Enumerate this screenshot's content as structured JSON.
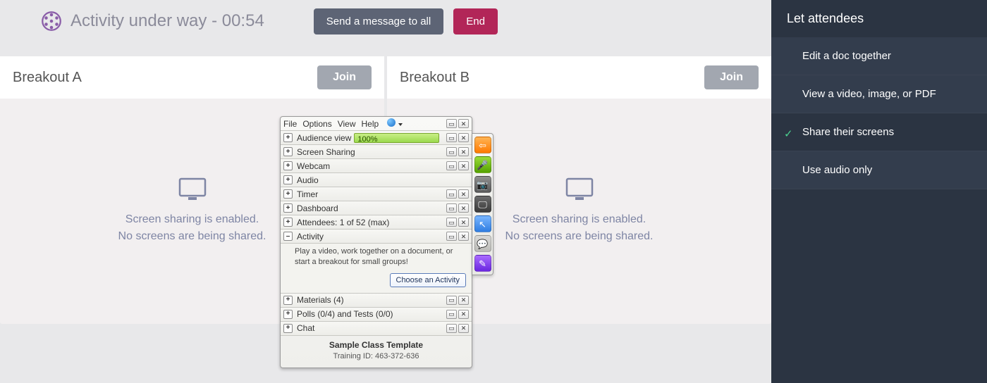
{
  "header": {
    "title": "Activity under way - 00:54",
    "send_all_label": "Send a message to all",
    "end_label": "End"
  },
  "breakouts": [
    {
      "name": "Breakout A",
      "join_label": "Join",
      "msg1": "Screen sharing is enabled.",
      "msg2": "No screens are being shared."
    },
    {
      "name": "Breakout B",
      "join_label": "Join",
      "msg1": "Screen sharing is enabled.",
      "msg2": "No screens are being shared."
    }
  ],
  "rightbar": {
    "title": "Let attendees",
    "items": [
      {
        "label": "Edit a doc together",
        "selected": false
      },
      {
        "label": "View a video, image, or PDF",
        "selected": false
      },
      {
        "label": "Share their screens",
        "selected": true
      },
      {
        "label": "Use audio only",
        "selected": false
      }
    ]
  },
  "panel": {
    "menus": {
      "file": "File",
      "options": "Options",
      "view": "View",
      "help": "Help"
    },
    "rows": {
      "audience": {
        "label": "Audience view",
        "progress_text": "100%"
      },
      "sharing": "Screen Sharing",
      "webcam": "Webcam",
      "audio": "Audio",
      "timer": "Timer",
      "dashboard": "Dashboard",
      "attendees": "Attendees:  1 of 52 (max)",
      "activity_label": "Activity",
      "activity_desc": "Play a video, work together on a document, or start a breakout for small groups!",
      "choose_label": "Choose an Activity",
      "materials": "Materials (4)",
      "polls": "Polls (0/4) and Tests (0/0)",
      "chat": "Chat"
    },
    "footer": {
      "title": "Sample Class Template",
      "id_label": "Training ID: 463-372-636"
    },
    "tools": {
      "back": "back-arrow-icon",
      "mic": "microphone-icon",
      "cam": "camera-icon",
      "screen": "screen-icon",
      "pointer": "cursor-icon",
      "chat": "chat-bubble-icon",
      "draw": "highlighter-icon"
    }
  }
}
